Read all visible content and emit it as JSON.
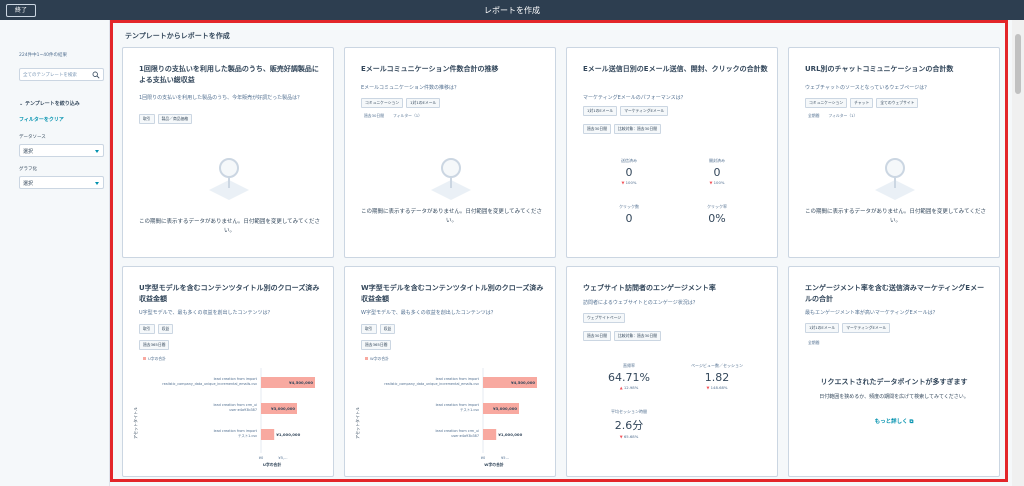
{
  "header": {
    "exit_label": "終了",
    "title": "レポートを作成"
  },
  "sidebar": {
    "count": "224件中1~40件の結果",
    "search_placeholder": "全てのテンプレートを検索",
    "filter_heading": "テンプレートを絞り込み",
    "clear_label": "フィルターをクリア",
    "datasource_label": "データソース",
    "datasource_value": "選択",
    "charttype_label": "グラフ化",
    "charttype_value": "選択"
  },
  "main": {
    "title": "テンプレートからレポートを作成"
  },
  "cards": [
    {
      "title": "1回限りの支払いを利用した製品のうち、販売好調製品による支払い総収益",
      "desc": "1回限りの支払いを利用した製品のうち、今年販売が好調だった製品は？",
      "tags": [
        "取引",
        "製品／商品価格"
      ],
      "empty": "この期間に表示するデータがありません。日付範囲を変更してみてください。"
    },
    {
      "title": "Eメールコミュニケーション件数合計の推移",
      "desc": "Eメールコミュニケーション件数の推移は？",
      "tags": [
        "コミュニケーション",
        "1対1のEメール"
      ],
      "tags2": [
        "過去30日間",
        "フィルター（1）"
      ],
      "empty": "この期間に表示するデータがありません。日付範囲を変更してみてください。"
    },
    {
      "title": "Eメール送信日別のEメール送信、開封、クリックの合計数",
      "desc": "マーケティングEメールのパフォーマンスは？",
      "tags": [
        "1対1のEメール",
        "マーケティングEメール"
      ],
      "tags2": [
        "過去30日間",
        "比較対象：過去30日間"
      ],
      "metrics": [
        {
          "label": "送信済み",
          "value": "0",
          "change": "100%"
        },
        {
          "label": "開封済み",
          "value": "0",
          "change": "100%"
        },
        {
          "label": "クリック数",
          "value": "0",
          "change": ""
        },
        {
          "label": "クリック率",
          "value": "0%",
          "change": ""
        }
      ]
    },
    {
      "title": "URL別のチャットコミュニケーションの合計数",
      "desc": "ウェブチャットのソースとなっているウェブページは？",
      "tags": [
        "コミュニケーション",
        "チャット",
        "全てのウェブサイト"
      ],
      "tags2": [
        "全期間",
        "フィルター（1）"
      ],
      "empty": "この期間に表示するデータがありません。日付範囲を変更してみてください。"
    },
    {
      "title": "U字型モデルを含むコンテンツタイトル別のクローズ済み収益金額",
      "desc": "U字型モデルで、最も多くの収益を創出したコンテンツは？",
      "tags": [
        "取引",
        "収益"
      ],
      "tags2": [
        "過去365日間"
      ],
      "legend": "U字の合計",
      "ylabel": "アセットタイトル",
      "xlabel": "U字の合計",
      "bars": [
        {
          "label": "lead creation from import\nrealistic_company_data_unique_incremental_emails.csv",
          "value": "¥4,500,000",
          "frac": 0.9
        },
        {
          "label": "lead creation from crm_ui\nuser:e4a93b387",
          "value": "¥3,000,000",
          "frac": 0.6
        },
        {
          "label": "lead creation from import\nテスト1.csv",
          "value": "¥1,000,000",
          "frac": 0.22
        }
      ],
      "ticks": [
        "¥0",
        "¥5,..."
      ]
    },
    {
      "title": "W字型モデルを含むコンテンツタイトル別のクローズ済み収益金額",
      "desc": "W字型モデルで、最も多くの収益を創出したコンテンツは？",
      "tags": [
        "取引",
        "収益"
      ],
      "tags2": [
        "過去365日間"
      ],
      "legend": "W字の合計",
      "ylabel": "アセットタイトル",
      "xlabel": "W字の合計",
      "bars": [
        {
          "label": "lead creation from import\nrealistic_company_data_unique_incremental_emails.csv",
          "value": "¥4,500,000",
          "frac": 0.9
        },
        {
          "label": "lead creation from import\nテスト1.csv",
          "value": "¥3,000,000",
          "frac": 0.6
        },
        {
          "label": "lead creation from crm_ui\nuser:e4a93b387",
          "value": "¥1,000,000",
          "frac": 0.22
        }
      ],
      "ticks": [
        "¥0",
        "¥5..."
      ]
    },
    {
      "title": "ウェブサイト訪問者のエンゲージメント率",
      "desc": "訪問者によるウェブサイトとのエンゲージ状況は？",
      "tags": [
        "ウェブサイトページ"
      ],
      "tags2": [
        "過去30日間",
        "比較対象：過去30日間"
      ],
      "metrics": [
        {
          "label": "直帰率",
          "value": "64.71%",
          "change": "12.98%",
          "dir": "up"
        },
        {
          "label": "ページビュー数／セッション",
          "value": "1.82",
          "change": "148.68%",
          "dir": "down"
        },
        {
          "label": "平均セッション時間",
          "value": "2.6分",
          "change": "65.68%",
          "dir": "down"
        }
      ]
    },
    {
      "title": "エンゲージメント率を含む送信済みマーケティングEメールの合計",
      "desc": "最もエンゲージメント率が高いマーケティングEメールは？",
      "tags": [
        "1対1のEメール",
        "マーケティングEメール"
      ],
      "tags2": [
        "全期間"
      ],
      "notice_title": "リクエストされたデータポイントが多すぎます",
      "notice_body": "日付範囲を狭めるか、頻度の期間を広げて検索してみてください。",
      "notice_link": "もっと詳しく ⧉"
    }
  ],
  "colors": {
    "bar": "#f8a9a0",
    "accent": "#0091ae",
    "border_highlight": "#e3262a"
  }
}
